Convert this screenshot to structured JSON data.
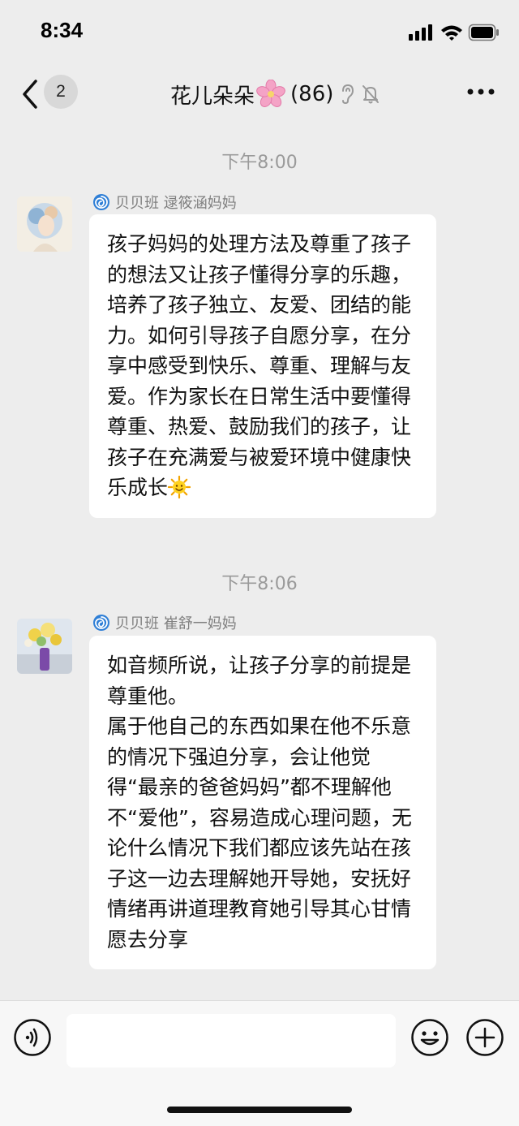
{
  "status_bar": {
    "time": "8:34"
  },
  "nav": {
    "unread_count": "2",
    "title": "花儿朵朵",
    "member_count": "(86)"
  },
  "messages": [
    {
      "timestamp": "下午8:00",
      "sender": "贝贝班 逯筱涵妈妈",
      "text": "孩子妈妈的处理方法及尊重了孩子的想法又让孩子懂得分享的乐趣，培养了孩子独立、友爱、团结的能力。如何引导孩子自愿分享，在分享中感受到快乐、尊重、理解与友爱。作为家长在日常生活中要懂得尊重、热爱、鼓励我们的孩子，让孩子在充满爱与被爱环境中健康快乐成长",
      "trailing_emoji": "sun-icon"
    },
    {
      "timestamp": "下午8:06",
      "sender": "贝贝班 崔舒一妈妈",
      "text": "如音频所说，让孩子分享的前提是尊重他。\n属于他自己的东西如果在他不乐意的情况下强迫分享，会让他觉得“最亲的爸爸妈妈”都不理解他不“爱他”，容易造成心理问题，无论什么情况下我们都应该先站在孩子这一边去理解她开导她，安抚好情绪再讲道理教育她引导其心甘情愿去分享"
    }
  ],
  "input": {
    "placeholder": ""
  },
  "colors": {
    "background": "#ededed",
    "bubble": "#ffffff",
    "timestamp": "#9a9a9a",
    "sender": "#7f7f7f",
    "swirl_blue": "#2f7fd6"
  }
}
